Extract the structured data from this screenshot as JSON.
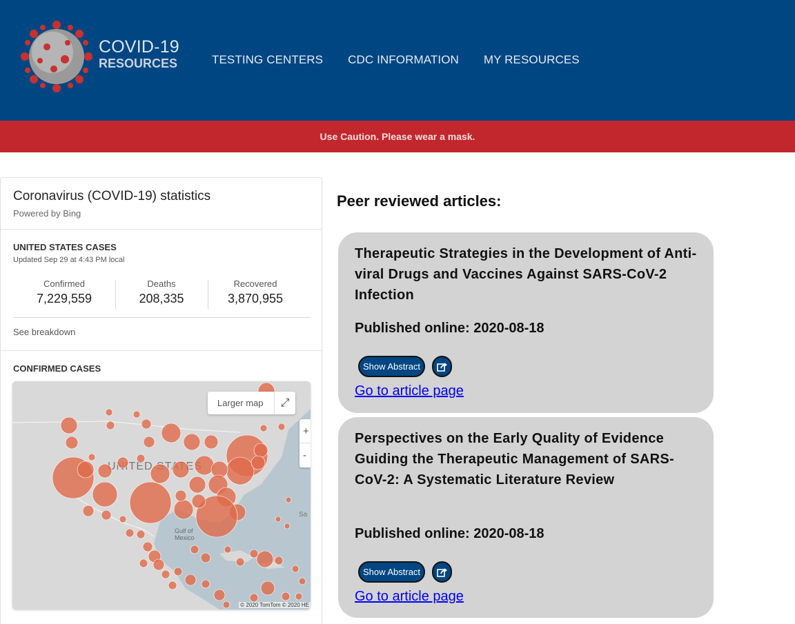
{
  "header": {
    "brand_line1": "COVID-19",
    "brand_line2": "RESOURCES",
    "nav": [
      "TESTING CENTERS",
      "CDC INFORMATION",
      "MY RESOURCES"
    ],
    "colors": {
      "header_bg": "#004683",
      "caution_bg": "#c1272d"
    },
    "logo_icon": "coronavirus-logo-icon"
  },
  "caution": "Use Caution. Please wear a mask.",
  "stats_widget": {
    "title": "Coronavirus (COVID-19) statistics",
    "subtitle": "Powered by Bing",
    "section_title": "UNITED STATES CASES",
    "updated": "Updated Sep 29 at 4:43 PM local",
    "stats": [
      {
        "label": "Confirmed",
        "value": "7,229,559"
      },
      {
        "label": "Deaths",
        "value": "208,335"
      },
      {
        "label": "Recovered",
        "value": "3,870,955"
      }
    ],
    "breakdown_link": "See breakdown",
    "map_title": "CONFIRMED CASES",
    "map": {
      "larger_map": "Larger map",
      "zoom_in": "+",
      "zoom_out": "-",
      "country_label": "UNITED STATES",
      "gulf_label_1": "Gulf of",
      "gulf_label_2": "Mexico",
      "sea_label": "Sa",
      "copyright": "© 2020 TomTom © 2020 HE"
    }
  },
  "articles": {
    "heading": "Peer reviewed articles:",
    "items": [
      {
        "title": "Therapeutic Strategies in the Development of Anti-viral Drugs and Vaccines Against SARS-CoV-2 Infection",
        "published": "Published online: 2020-08-18",
        "abstract_button": "Show Abstract",
        "link": "Go to article page"
      },
      {
        "title": "Perspectives on the Early Quality of Evidence Guiding the Therapeutic Management of SARS-CoV-2: A Systematic Literature Review",
        "published": "Published online: 2020-08-18",
        "abstract_button": "Show Abstract",
        "link": "Go to article page"
      }
    ]
  }
}
